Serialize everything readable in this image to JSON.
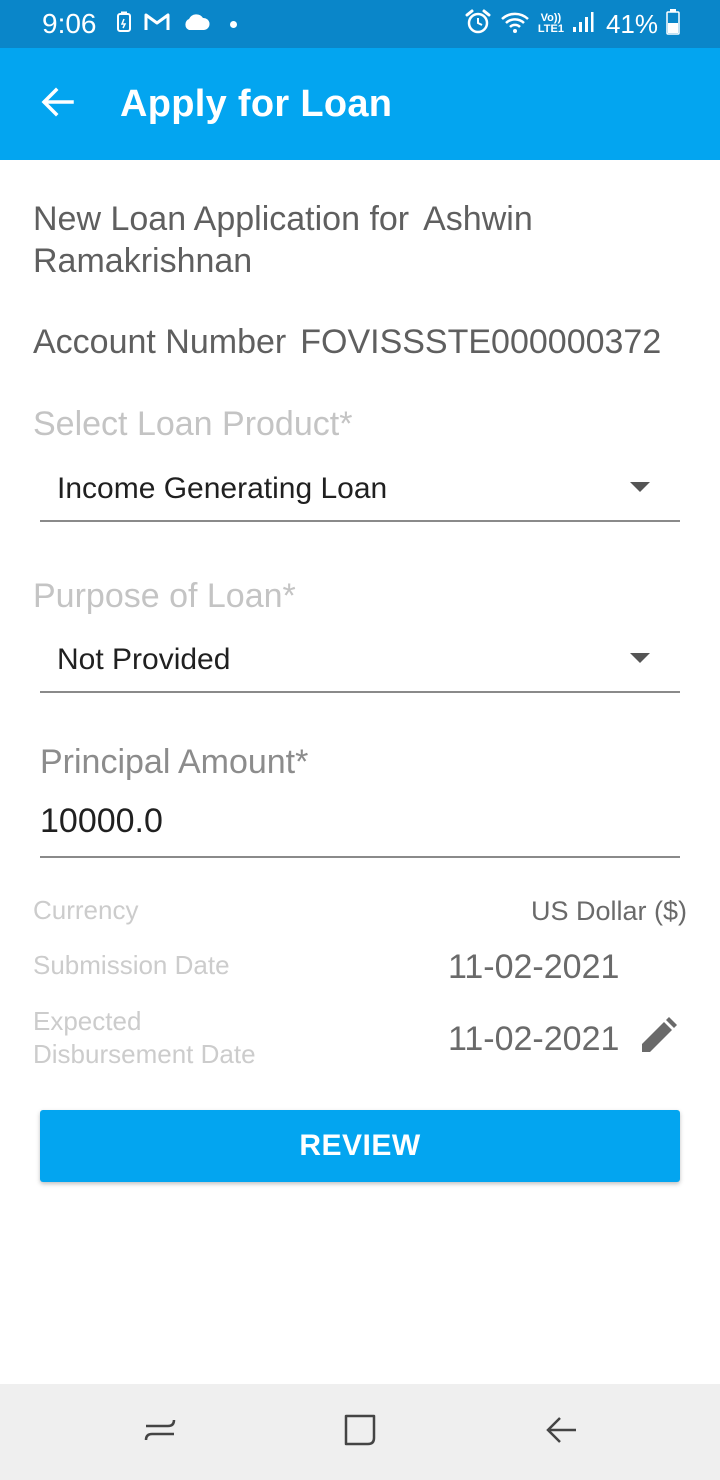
{
  "status_bar": {
    "time": "9:06",
    "battery": "41%",
    "left_icons": [
      "battery-saver-icon",
      "gmail-icon",
      "cloud-icon",
      "notification-dot-icon"
    ],
    "right_icons": [
      "alarm-icon",
      "wifi-icon",
      "volte-icon",
      "signal-icon",
      "battery-icon"
    ],
    "volte_label_top": "Vo))",
    "volte_label_bottom": "LTE1"
  },
  "app_bar": {
    "title": "Apply for Loan",
    "back_icon": "arrow-back-icon"
  },
  "applicant": {
    "prefix": "New Loan Application for",
    "name": "Ashwin Ramakrishnan"
  },
  "account": {
    "label": "Account Number",
    "value": "FOVISSSTE000000372"
  },
  "loan_product": {
    "label": "Select Loan Product*",
    "selected": "Income Generating Loan"
  },
  "loan_purpose": {
    "label": "Purpose of Loan*",
    "selected": "Not Provided"
  },
  "principal": {
    "label": "Principal Amount*",
    "value": "10000.0"
  },
  "currency": {
    "label": "Currency",
    "value": "US Dollar ($)"
  },
  "submission_date": {
    "label": "Submission Date",
    "value": "11-02-2021"
  },
  "disbursement_date": {
    "label_line1": "Expected",
    "label_line2": "Disbursement Date",
    "value": "11-02-2021",
    "edit_icon": "pencil-icon"
  },
  "review_button": {
    "label": "REVIEW"
  },
  "nav_bar": {
    "icons": [
      "recents-icon",
      "home-icon",
      "back-icon"
    ]
  },
  "colors": {
    "status_bar": "#0a86c9",
    "app_bar": "#03a5f0",
    "button": "#03a5f0",
    "nav_bar": "#efefef"
  }
}
